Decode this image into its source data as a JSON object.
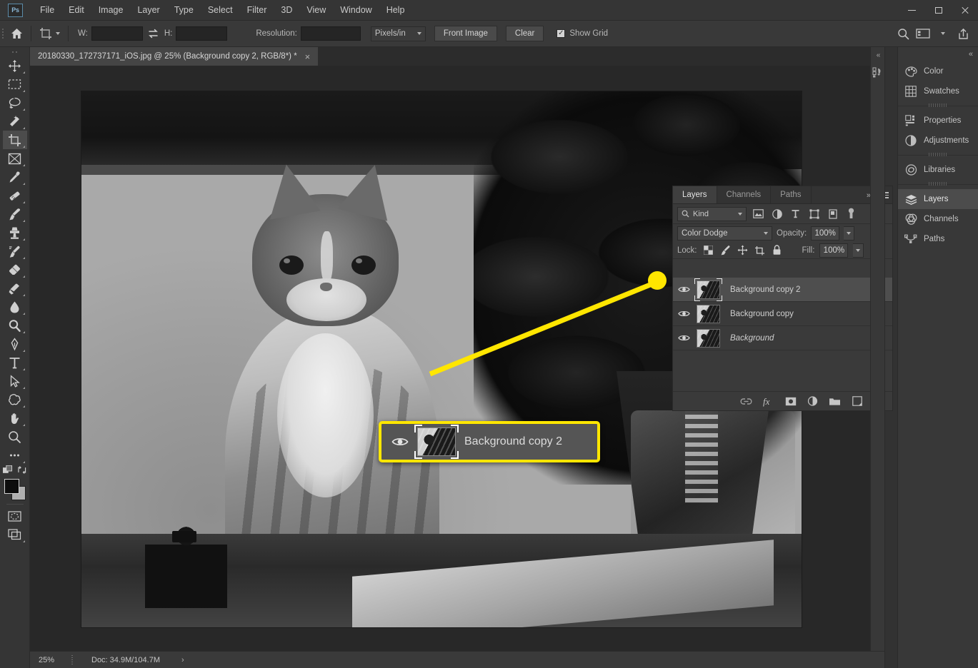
{
  "app": {
    "logo": "Ps",
    "title": "Adobe Photoshop"
  },
  "menubar": {
    "items": [
      "File",
      "Edit",
      "Image",
      "Layer",
      "Type",
      "Select",
      "Filter",
      "3D",
      "View",
      "Window",
      "Help"
    ]
  },
  "window_controls": {
    "minimize": "minimize-icon",
    "maximize": "maximize-icon",
    "close": "close-icon"
  },
  "options_bar": {
    "home_icon": "home-icon",
    "tool_icon": "crop-tool-icon",
    "width_label": "W:",
    "width_value": "",
    "width_placeholder": "",
    "swap_icon": "swap-arrows-icon",
    "height_label": "H:",
    "height_value": "",
    "height_placeholder": "",
    "resolution_label": "Resolution:",
    "resolution_value": "",
    "resolution_placeholder": "",
    "units": "Pixels/in",
    "front_image_button": "Front Image",
    "clear_button": "Clear",
    "show_grid_label": "Show Grid",
    "show_grid_checked": true,
    "check_glyph": "✓",
    "right_icons": [
      "search-icon",
      "workspace-icon",
      "share-icon"
    ]
  },
  "document_tab": {
    "title": "20180330_172737171_iOS.jpg @ 25% (Background copy 2, RGB/8*) *",
    "close_glyph": "×"
  },
  "toolbar": {
    "tools": [
      {
        "name": "move-tool",
        "active": false
      },
      {
        "name": "rectangular-marquee-tool",
        "active": false
      },
      {
        "name": "lasso-tool",
        "active": false
      },
      {
        "name": "magic-wand-tool",
        "active": false
      },
      {
        "name": "crop-tool",
        "active": true
      },
      {
        "name": "frame-tool",
        "active": false
      },
      {
        "name": "eyedropper-tool",
        "active": false
      },
      {
        "name": "healing-brush-tool",
        "active": false
      },
      {
        "name": "brush-tool",
        "active": false
      },
      {
        "name": "clone-stamp-tool",
        "active": false
      },
      {
        "name": "history-brush-tool",
        "active": false
      },
      {
        "name": "eraser-tool",
        "active": false
      },
      {
        "name": "gradient-tool",
        "active": false
      },
      {
        "name": "blur-tool",
        "active": false
      },
      {
        "name": "dodge-tool",
        "active": false
      },
      {
        "name": "pen-tool",
        "active": false
      },
      {
        "name": "type-tool",
        "active": false
      },
      {
        "name": "path-selection-tool",
        "active": false
      },
      {
        "name": "shape-tool",
        "active": false
      },
      {
        "name": "hand-tool",
        "active": false
      },
      {
        "name": "zoom-tool",
        "active": false
      },
      {
        "name": "edit-toolbar-tool",
        "active": false
      }
    ],
    "foreground_color": "#0d0d0d",
    "background_color": "#b0b0b0",
    "quick_mask_icon": "quick-mask-icon",
    "screen_mode_icon": "screen-mode-icon"
  },
  "layers_panel": {
    "tabs": [
      {
        "label": "Layers",
        "active": true
      },
      {
        "label": "Channels",
        "active": false
      },
      {
        "label": "Paths",
        "active": false
      }
    ],
    "collapse_glyph": "»",
    "filter": {
      "kind_label": "Kind",
      "search_icon": "search-icon",
      "icons": [
        "pixel-layer-filter-icon",
        "adjustment-layer-filter-icon",
        "type-layer-filter-icon",
        "shape-layer-filter-icon",
        "smart-object-filter-icon",
        "filter-toggle-icon"
      ]
    },
    "blend_mode": "Color Dodge",
    "opacity_label": "Opacity:",
    "opacity_value": "100%",
    "fill_label": "Fill:",
    "fill_value": "100%",
    "lock_label": "Lock:",
    "lock_icons": [
      "lock-transparent-pixels-icon",
      "lock-image-pixels-icon",
      "lock-position-icon",
      "lock-artboard-icon",
      "lock-all-icon"
    ],
    "layers": [
      {
        "name": "Background copy 2",
        "visible": true,
        "selected": true,
        "locked": false,
        "italic": false
      },
      {
        "name": "Background copy",
        "visible": true,
        "selected": false,
        "locked": false,
        "italic": false
      },
      {
        "name": "Background",
        "visible": true,
        "selected": false,
        "locked": true,
        "italic": true
      }
    ],
    "footer_icons": [
      "link-layers-icon",
      "layer-style-fx-icon",
      "add-layer-mask-icon",
      "new-adjustment-layer-icon",
      "new-group-icon",
      "new-layer-icon",
      "delete-layer-icon"
    ]
  },
  "callout": {
    "layer_name": "Background copy 2",
    "eye_icon": "eye-icon",
    "thumbnail": "layer-thumbnail",
    "highlight_color": "#ffe600"
  },
  "right_dock": {
    "collapse_glyph": "«",
    "items": [
      {
        "label": "Color",
        "icon": "color-panel-icon",
        "active": false
      },
      {
        "label": "Swatches",
        "icon": "swatches-panel-icon",
        "active": false
      },
      {
        "label": "Properties",
        "icon": "properties-panel-icon",
        "active": false
      },
      {
        "label": "Adjustments",
        "icon": "adjustments-panel-icon",
        "active": false
      },
      {
        "label": "Libraries",
        "icon": "libraries-panel-icon",
        "active": false
      },
      {
        "label": "Layers",
        "icon": "layers-panel-icon",
        "active": true
      },
      {
        "label": "Channels",
        "icon": "channels-panel-icon",
        "active": false
      },
      {
        "label": "Paths",
        "icon": "paths-panel-icon",
        "active": false
      }
    ]
  },
  "status_bar": {
    "zoom": "25%",
    "doc_info": "Doc: 34.9M/104.7M",
    "expand_glyph": "›"
  }
}
